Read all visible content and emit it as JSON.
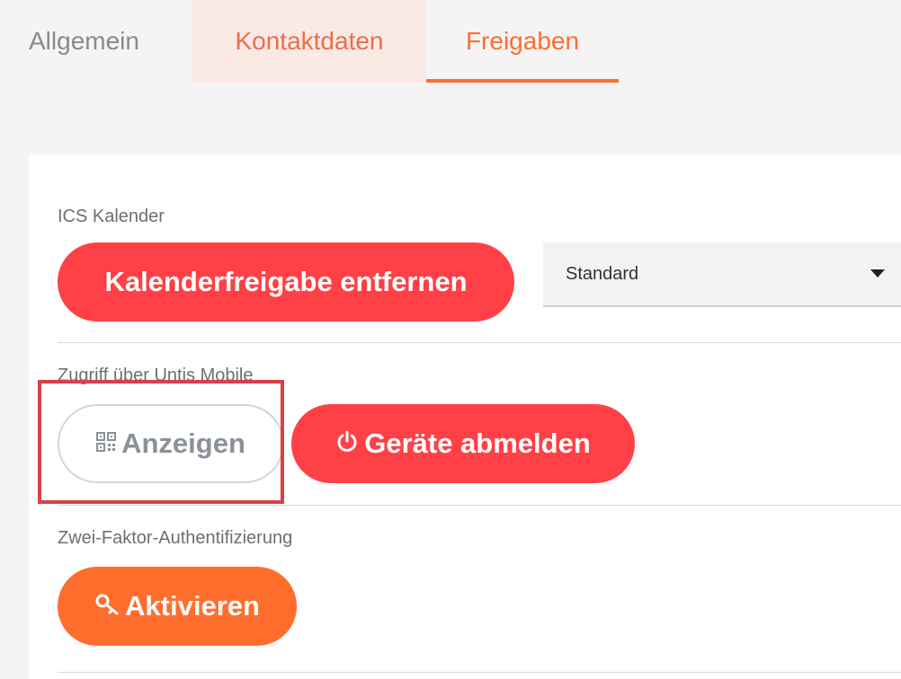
{
  "tabs": [
    {
      "label": "Allgemein"
    },
    {
      "label": "Kontaktdaten"
    },
    {
      "label": "Freigaben"
    }
  ],
  "active_tab": "Freigaben",
  "sections": {
    "ics": {
      "label": "ICS Kalender",
      "remove_button": "Kalenderfreigabe entfernen",
      "select_value": "Standard"
    },
    "untis": {
      "label": "Zugriff über Untis Mobile",
      "show_button": "Anzeigen",
      "logout_button": "Geräte abmelden"
    },
    "twofa": {
      "label": "Zwei-Faktor-Authentifizierung",
      "activate_button": "Aktivieren"
    }
  },
  "icons": {
    "show": "qr-code-icon",
    "logout": "power-icon",
    "activate": "key-icon",
    "select": "caret-down-icon"
  },
  "colors": {
    "accent": "#ff6d2d",
    "danger": "#ff4046",
    "highlight": "#d9404a"
  }
}
